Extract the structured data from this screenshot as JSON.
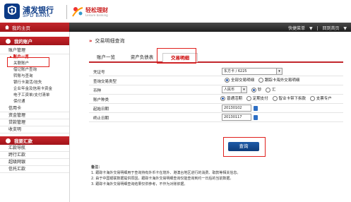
{
  "header": {
    "bank_logo_text": "浦发银行",
    "bank_logo_en": "SPD BANK",
    "product_name": "轻松理财",
    "product_en": "Leisure banking"
  },
  "topbar": {
    "home_label": "我的主页",
    "right_links": [
      "快捷菜单",
      "▼",
      "|",
      "回到首页",
      "▼"
    ]
  },
  "sidebar": {
    "my_account_title": "我的账户",
    "categories": [
      {
        "label": "账户管理",
        "items": [
          "账户一览",
          "关联账户",
          "借记账户查询",
          "转账与查询",
          "银行卡激活/挂失",
          "企业年金及信用卡资金",
          "电子工资单/支付清单",
          "保付通"
        ]
      },
      {
        "label": "信用卡",
        "items": []
      },
      {
        "label": "资金管理",
        "items": []
      },
      {
        "label": "贷款管理",
        "items": []
      },
      {
        "label": "收支明",
        "items": []
      }
    ],
    "transfer_title": "我要汇款",
    "transfer_items": [
      "汇款导航",
      "跨行汇款",
      "超级网银",
      "信托汇款"
    ]
  },
  "main": {
    "breadcrumb": "交易明细查询",
    "tabs": [
      "账户一览",
      "资产负债表",
      "交易明细"
    ],
    "active_tab_index": 2,
    "form": {
      "account_label": "凭证号",
      "account_value": "东方卡 / 6225",
      "query_type_label": "查询交易类型",
      "query_type_options": [
        "全部交易明细",
        "跟踪卡海外交易明细"
      ],
      "currency_label": "币种",
      "currency_value": "人民币",
      "cash_options": [
        "钞",
        "汇"
      ],
      "account_type_label": "账户种类",
      "account_type_options": [
        "普通活期",
        "定期支付",
        "智业卡带下拆款",
        "支票专户"
      ],
      "start_date_label": "起始日期",
      "start_date_value": "20130102",
      "end_date_label": "终止日期",
      "end_date_value": "20130117",
      "query_button": "查询"
    },
    "notes": {
      "title": "备注：",
      "lines": [
        "1. 跟踪卡海外交易明细用于查询持有外币卡在境外、港澳台地区进行的消费、取款等相关信息。",
        "2. 由于中国银联数据提供原因，跟踪卡海外交易明细查询仅能查询到约一日后的当前数据。",
        "3. 跟踪卡海外交易明细查询结果仅供参考，不作为对账依据。"
      ]
    }
  }
}
